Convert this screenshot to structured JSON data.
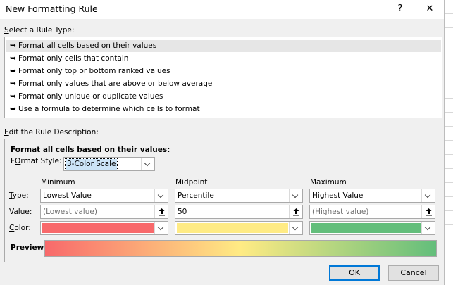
{
  "dialog": {
    "title": "New Formatting Rule",
    "help_symbol": "?",
    "close_symbol": "✕"
  },
  "rule_type": {
    "label_prefix": "",
    "label_mnemonic": "S",
    "label_rest": "elect a Rule Type:",
    "items": [
      {
        "label": "Format all cells based on their values",
        "selected": true
      },
      {
        "label": "Format only cells that contain",
        "selected": false
      },
      {
        "label": "Format only top or bottom ranked values",
        "selected": false
      },
      {
        "label": "Format only values that are above or below average",
        "selected": false
      },
      {
        "label": "Format only unique or duplicate values",
        "selected": false
      },
      {
        "label": "Use a formula to determine which cells to format",
        "selected": false
      }
    ]
  },
  "description": {
    "label_mnemonic": "E",
    "label_rest": "dit the Rule Description:",
    "heading": "Format all cells based on their values:",
    "format_style_mnemonic": "O",
    "format_style_prefix": "F",
    "format_style_rest": "rmat Style:",
    "format_style_value": "3-Color Scale",
    "row_labels": {
      "type_mnemonic": "T",
      "type_rest": "ype:",
      "value_mnemonic": "V",
      "value_rest": "alue:",
      "color_mnemonic": "C",
      "color_rest": "olor:"
    },
    "columns": [
      {
        "header": "Minimum",
        "type": "Lowest Value",
        "value": "",
        "value_placeholder": "(Lowest value)",
        "color": "#f8696b"
      },
      {
        "header": "Midpoint",
        "type": "Percentile",
        "value": "50",
        "value_placeholder": "",
        "color": "#ffeb84"
      },
      {
        "header": "Maximum",
        "type": "Highest Value",
        "value": "",
        "value_placeholder": "(Highest value)",
        "color": "#63be7b"
      }
    ],
    "preview_label": "Preview:"
  },
  "buttons": {
    "ok": "OK",
    "cancel": "Cancel"
  },
  "icons": {
    "rule_item_arrow": "arrow-right-icon",
    "reference": "collapse-dialog-icon",
    "dropdown": "chevron-down-icon"
  }
}
